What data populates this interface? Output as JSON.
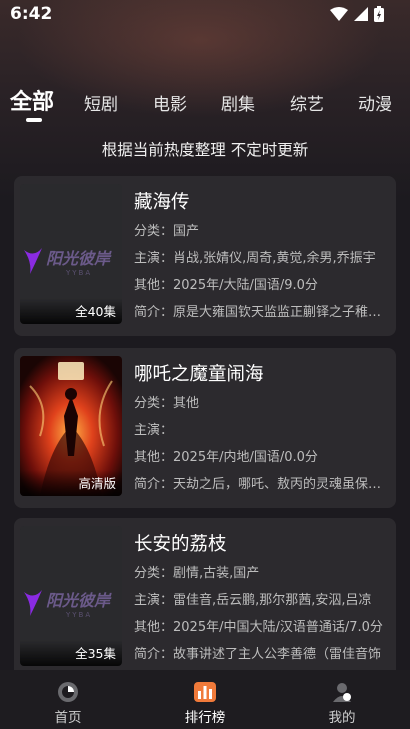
{
  "status": {
    "time": "6:42"
  },
  "tabs": [
    {
      "label": "全部",
      "active": true
    },
    {
      "label": "短剧"
    },
    {
      "label": "电影"
    },
    {
      "label": "剧集"
    },
    {
      "label": "综艺"
    },
    {
      "label": "动漫"
    }
  ],
  "subtitle": "根据当前热度整理 不定时更新",
  "items": [
    {
      "title": "藏海传",
      "badge": "全40集",
      "category": "分类：国产",
      "cast": "主演：肖战,张婧仪,周奇,黄觉,余男,乔振宇",
      "other": "其他：2025年/大陆/国语/9.0分",
      "intro": "简介：原是大雍国钦天监监正蒯铎之子稚奴在",
      "poster": "logo"
    },
    {
      "title": "哪吒之魔童闹海",
      "badge": "高清版",
      "category": "分类：其他",
      "cast": "主演：",
      "other": "其他：2025年/内地/国语/0.0分",
      "intro": "简介：天劫之后，哪吒、敖丙的灵魂虽保住了",
      "poster": "movie"
    },
    {
      "title": "长安的荔枝",
      "badge": "全35集",
      "category": "分类：剧情,古装,国产",
      "cast": "主演：雷佳音,岳云鹏,那尔那茜,安泅,吕凉",
      "other": "其他：2025年/中国大陆/汉语普通话/7.0分",
      "intro": "简介：故事讲述了主人公李善德（雷佳音饰",
      "poster": "logo"
    }
  ],
  "logo_text": {
    "main": "阳光彼岸",
    "sub": "YYBA"
  },
  "nav": [
    {
      "label": "首页",
      "icon": "home-icon"
    },
    {
      "label": "排行榜",
      "icon": "ranking-icon",
      "active": true
    },
    {
      "label": "我的",
      "icon": "profile-icon"
    }
  ]
}
